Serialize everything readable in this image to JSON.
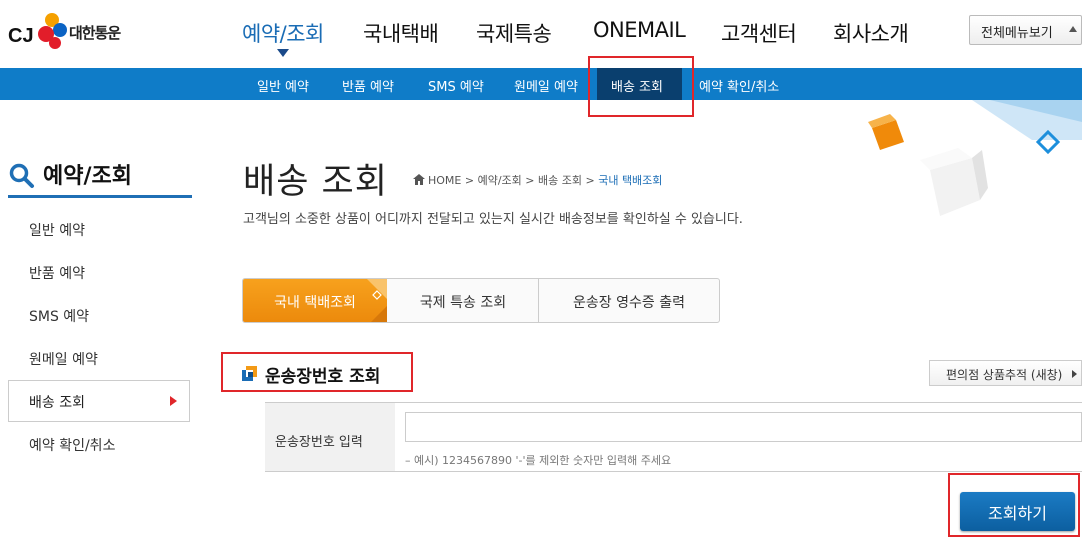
{
  "brand": {
    "logo_mark": "CJ",
    "name": "대한통운"
  },
  "gnb": {
    "items": [
      "예약/조회",
      "국내택배",
      "국제특송",
      "ONEMAIL",
      "고객센터",
      "회사소개"
    ],
    "all_menu_label": "전체메뉴보기"
  },
  "subnav": {
    "items": [
      "일반 예약",
      "반품 예약",
      "SMS 예약",
      "원메일 예약",
      "배송 조회",
      "예약 확인/취소"
    ],
    "active": "배송 조회"
  },
  "lnb": {
    "title": "예약/조회",
    "items": [
      "일반 예약",
      "반품 예약",
      "SMS 예약",
      "원메일 예약",
      "배송 조회",
      "예약 확인/취소"
    ],
    "active": "배송 조회"
  },
  "page": {
    "title": "배송 조회",
    "breadcrumb": [
      "HOME",
      "예약/조회",
      "배송 조회",
      "국내 택배조회"
    ],
    "description": "고객님의 소중한 상품이 어디까지 전달되고 있는지 실시간 배송정보를 확인하실 수 있습니다."
  },
  "tabs": [
    "국내 택배조회",
    "국제 특송 조회",
    "운송장 영수증 출력"
  ],
  "active_tab": "국내 택배조회",
  "section": {
    "title": "운송장번호 조회",
    "cvs_button_label": "편의점 상품추적 (새창)"
  },
  "form": {
    "label": "운송장번호 입력",
    "input_value": "",
    "hint": "– 예시) 1234567890 '-'를 제외한 숫자만 입력해 주세요",
    "submit_label": "조회하기"
  },
  "colors": {
    "primary_blue": "#0f7cc8",
    "active_orange": "#f39a16",
    "highlight_red": "#e0262a"
  }
}
